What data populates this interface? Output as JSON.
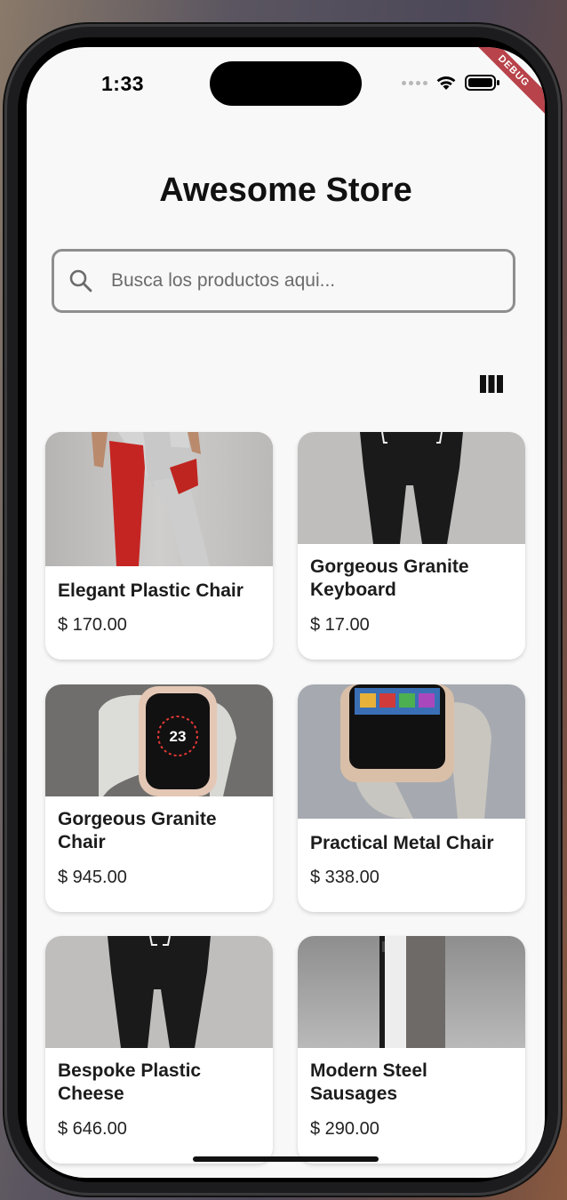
{
  "status_bar": {
    "time": "1:33",
    "debug_label": "DEBUG"
  },
  "header": {
    "title": "Awesome Store"
  },
  "search": {
    "placeholder": "Busca los productos aqui..."
  },
  "toolbar": {
    "view_toggle_icon": "view-column-icon"
  },
  "products": [
    {
      "name": "Elegant Plastic Chair",
      "price": "$ 170.00",
      "image": "red-grey-pants"
    },
    {
      "name": "Gorgeous Granite Keyboard",
      "price": "$ 17.00",
      "image": "black-pants"
    },
    {
      "name": "Gorgeous Granite Chair",
      "price": "$ 945.00",
      "image": "smartwatch-front"
    },
    {
      "name": "Practical Metal Chair",
      "price": "$ 338.00",
      "image": "smartwatch-side"
    },
    {
      "name": "Bespoke Plastic Cheese",
      "price": "$ 646.00",
      "image": "black-pants"
    },
    {
      "name": "Modern Steel Sausages",
      "price": "$ 290.00",
      "image": "phone-side"
    }
  ],
  "colors": {
    "background": "#f8f8f8",
    "card": "#ffffff",
    "search_border": "#8e8e8e",
    "debug_banner": "#b8434a"
  }
}
